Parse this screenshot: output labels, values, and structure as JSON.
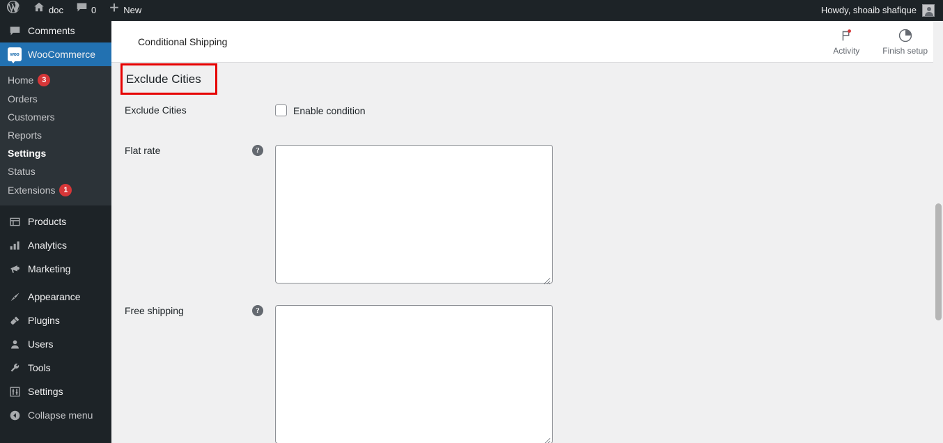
{
  "adminbar": {
    "wp_logo_icon": "wordpress-icon",
    "site_name": "doc",
    "site_icon": "home-icon",
    "comments_icon": "comment-bubble-icon",
    "comments_count": "0",
    "new_icon": "plus-icon",
    "new_label": "New",
    "greeting": "Howdy, shoaib shafique",
    "avatar_icon": "user-avatar-icon"
  },
  "sidebar": {
    "comments": {
      "label": "Comments",
      "icon": "comment-bubble-icon"
    },
    "woocommerce": {
      "label": "WooCommerce",
      "icon": "woocommerce-logo-icon"
    },
    "submenu": [
      {
        "label": "Home",
        "badge": "3",
        "current": false
      },
      {
        "label": "Orders",
        "badge": "",
        "current": false
      },
      {
        "label": "Customers",
        "badge": "",
        "current": false
      },
      {
        "label": "Reports",
        "badge": "",
        "current": false
      },
      {
        "label": "Settings",
        "badge": "",
        "current": true
      },
      {
        "label": "Status",
        "badge": "",
        "current": false
      },
      {
        "label": "Extensions",
        "badge": "1",
        "current": false
      }
    ],
    "items": [
      {
        "label": "Products",
        "icon": "products-box-icon"
      },
      {
        "label": "Analytics",
        "icon": "bar-chart-icon"
      },
      {
        "label": "Marketing",
        "icon": "megaphone-icon"
      },
      {
        "label": "Appearance",
        "icon": "paintbrush-icon"
      },
      {
        "label": "Plugins",
        "icon": "plug-icon"
      },
      {
        "label": "Users",
        "icon": "user-icon"
      },
      {
        "label": "Tools",
        "icon": "wrench-icon"
      },
      {
        "label": "Settings",
        "icon": "sliders-icon"
      }
    ],
    "collapse": {
      "label": "Collapse menu",
      "icon": "arrow-left-circle-icon"
    }
  },
  "wc_header": {
    "title": "Conditional Shipping",
    "activity": {
      "label": "Activity",
      "icon": "flag-with-dot-icon"
    },
    "finish_setup": {
      "label": "Finish setup",
      "icon": "pie-progress-icon"
    }
  },
  "form": {
    "section_title": "Exclude Cities",
    "rows": [
      {
        "label": "Exclude Cities",
        "type": "checkbox",
        "checkbox_label": "Enable condition",
        "checked": false,
        "has_help": false
      },
      {
        "label": "Flat rate",
        "type": "textarea",
        "value": "",
        "has_help": true,
        "help_icon": "question-mark-icon"
      },
      {
        "label": "Free shipping",
        "type": "textarea",
        "value": "",
        "has_help": true,
        "help_icon": "question-mark-icon"
      }
    ]
  },
  "colors": {
    "admin_dark": "#1d2327",
    "submenu_dark": "#2c3338",
    "woo_blue": "#2271b1",
    "badge_red": "#d63638",
    "highlight_red": "#e60000",
    "content_bg": "#f0f0f1"
  }
}
